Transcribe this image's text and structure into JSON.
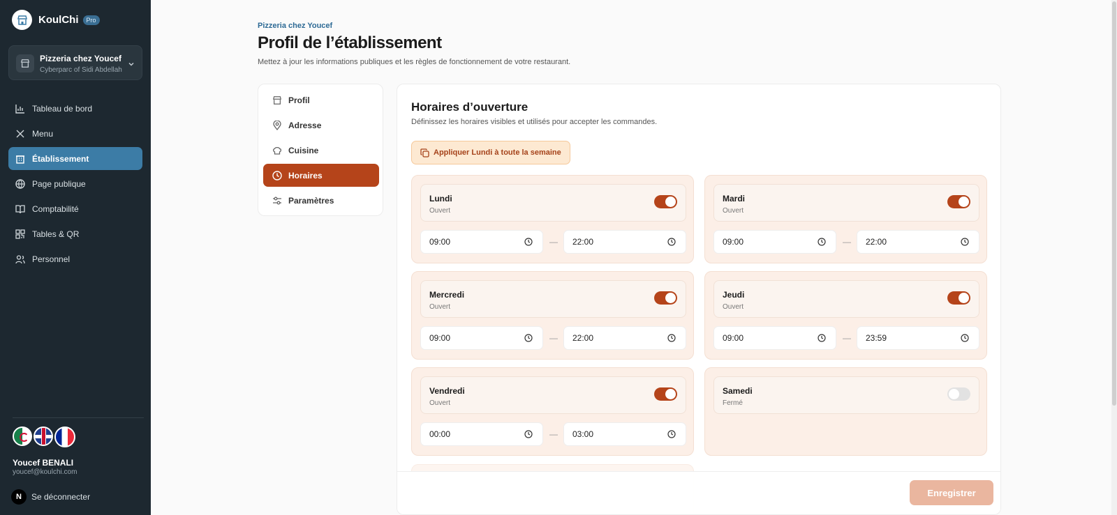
{
  "brand": {
    "name": "KoulChi",
    "badge": "Pro"
  },
  "store": {
    "name": "Pizzeria chez Youcef",
    "address": "Cyberparc of Sidi Abdellah"
  },
  "nav": [
    {
      "label": "Tableau de bord",
      "icon": "chart-icon"
    },
    {
      "label": "Menu",
      "icon": "utensils-icon"
    },
    {
      "label": "Établissement",
      "icon": "building-icon",
      "active": true
    },
    {
      "label": "Page publique",
      "icon": "globe-icon"
    },
    {
      "label": "Comptabilité",
      "icon": "book-icon"
    },
    {
      "label": "Tables & QR",
      "icon": "qr-icon"
    },
    {
      "label": "Personnel",
      "icon": "users-icon"
    }
  ],
  "user": {
    "name": "Youcef BENALI",
    "email": "youcef@koulchi.com",
    "logout": "Se déconnecter",
    "avatar_letter": "N"
  },
  "header": {
    "breadcrumb": "Pizzeria chez Youcef",
    "title": "Profil de l’établissement",
    "subtitle": "Mettez à jour les informations publiques et les règles de fonctionnement de votre restaurant."
  },
  "tabs": [
    {
      "label": "Profil",
      "icon": "store-icon"
    },
    {
      "label": "Adresse",
      "icon": "pin-icon"
    },
    {
      "label": "Cuisine",
      "icon": "chef-hat-icon"
    },
    {
      "label": "Horaires",
      "icon": "clock-icon",
      "active": true
    },
    {
      "label": "Paramètres",
      "icon": "sliders-icon"
    }
  ],
  "hours": {
    "title": "Horaires d’ouverture",
    "subtitle": "Définissez les horaires visibles et utilisés pour accepter les commandes.",
    "apply_label": "Appliquer Lundi à toute la semaine",
    "days": [
      {
        "name": "Lundi",
        "status": "Ouvert",
        "open": true,
        "from": "09:00",
        "to": "22:00"
      },
      {
        "name": "Mardi",
        "status": "Ouvert",
        "open": true,
        "from": "09:00",
        "to": "22:00"
      },
      {
        "name": "Mercredi",
        "status": "Ouvert",
        "open": true,
        "from": "09:00",
        "to": "22:00"
      },
      {
        "name": "Jeudi",
        "status": "Ouvert",
        "open": true,
        "from": "09:00",
        "to": "23:59"
      },
      {
        "name": "Vendredi",
        "status": "Ouvert",
        "open": true,
        "from": "00:00",
        "to": "03:00"
      },
      {
        "name": "Samedi",
        "status": "Fermé",
        "open": false,
        "from": "",
        "to": ""
      }
    ],
    "separator": "—"
  },
  "save_label": "Enregistrer",
  "colors": {
    "accent": "#b5441a",
    "sidebar": "#1d2830",
    "active_nav": "#3c7ca6"
  }
}
